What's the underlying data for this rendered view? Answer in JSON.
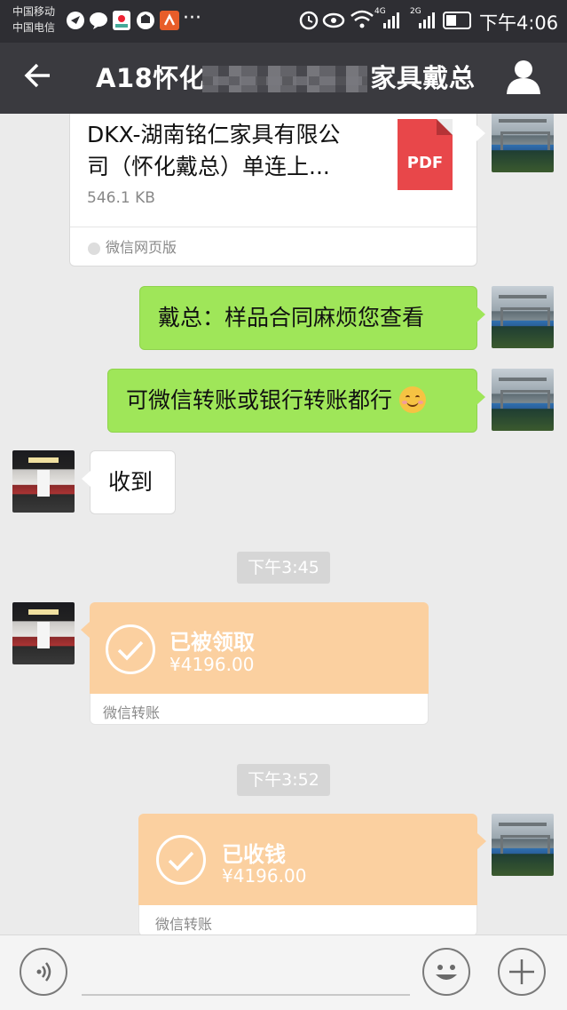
{
  "status_bar": {
    "carrier1": "中国移动",
    "carrier2": "中国电信",
    "dots": "···",
    "net1": "4G",
    "net2": "2G",
    "time": "下午4:06"
  },
  "header": {
    "title_prefix": "A18怀化",
    "title_suffix": "家具戴总"
  },
  "messages": {
    "file": {
      "name_line1": "DKX-湖南铭仁家具有限公",
      "name_line2": "司（怀化戴总）单连上...",
      "size": "546.1 KB",
      "badge": "PDF",
      "source": "微信网页版"
    },
    "sent1": "戴总：样品合同麻烦您查看",
    "sent2": "可微信转账或银行转账都行",
    "received1": "收到",
    "time1": "下午3:45",
    "transfer1": {
      "status": "已被领取",
      "amount": "¥4196.00",
      "footer": "微信转账"
    },
    "time2": "下午3:52",
    "transfer2": {
      "status": "已收钱",
      "amount": "¥4196.00",
      "footer": "微信转账"
    }
  },
  "colors": {
    "sent_bubble": "#9fe659",
    "transfer_bubble": "#fbd0a0",
    "header_bg": "#3a3a3f"
  },
  "icons": [
    "back-arrow-icon",
    "profile-icon",
    "voice-icon",
    "emoji-icon",
    "plus-icon",
    "pdf-icon",
    "check-icon"
  ]
}
